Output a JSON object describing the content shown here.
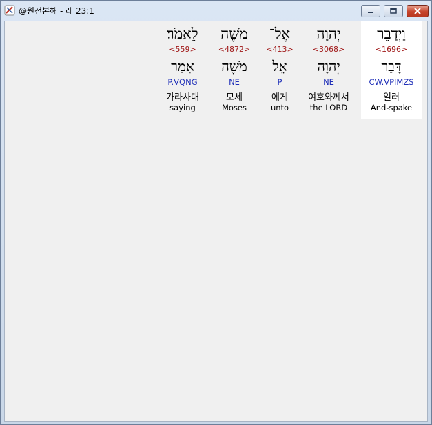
{
  "window": {
    "title": "@원전본해 - 레 23:1",
    "controls": {
      "minimize_icon": "minimize-icon",
      "maximize_icon": "maximize-icon",
      "close_icon": "close-icon"
    }
  },
  "words": [
    {
      "hebrew": "לֵאמֹר׃",
      "strong": "<559>",
      "lemma": "אָמַר",
      "morph": "P.VQNG",
      "korean": "가라사대",
      "english": "saying",
      "selected": false
    },
    {
      "hebrew": "מֹשֶׁה",
      "strong": "<4872>",
      "lemma": "מֹשֶׁה",
      "morph": "NE",
      "korean": "모세",
      "english": "Moses",
      "selected": false
    },
    {
      "hebrew": "אֶל־",
      "strong": "<413>",
      "lemma": "אֵל",
      "morph": "P",
      "korean": "에게",
      "english": "unto",
      "selected": false
    },
    {
      "hebrew": "יְהוָה",
      "strong": "<3068>",
      "lemma": "יְהוָה",
      "morph": "NE",
      "korean": "여호와께서",
      "english": "the LORD",
      "selected": false
    },
    {
      "hebrew": "וַיְדַבֵּר",
      "strong": "<1696>",
      "lemma": "דָּבַר",
      "morph": "CW.VPIMZS",
      "korean": "일러",
      "english": "And-spake",
      "selected": true
    }
  ],
  "colors": {
    "strong": "#a01818",
    "morph": "#1f2fb8",
    "client_bg": "#f0f0f0",
    "selected_bg": "#ffffff"
  }
}
